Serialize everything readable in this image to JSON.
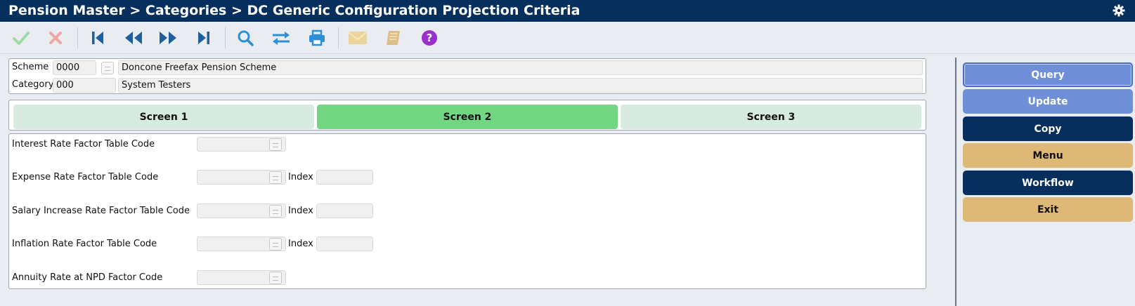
{
  "window": {
    "title": "Pension Master > Categories > DC Generic Configuration Projection Criteria"
  },
  "toolbar": {
    "icons": [
      "accept-icon",
      "cancel-icon",
      "first-record-icon",
      "previous-record-icon",
      "next-record-icon",
      "last-record-icon",
      "search-icon",
      "swap-icon",
      "print-icon",
      "mail-icon",
      "notes-icon",
      "help-icon"
    ]
  },
  "header": {
    "scheme_label": "Scheme",
    "scheme_code": "0000",
    "scheme_name": "Doncone Freefax Pension Scheme",
    "category_label": "Category",
    "category_code": "000",
    "category_name": "System Testers"
  },
  "tabs": [
    {
      "label": "Screen 1",
      "active": false
    },
    {
      "label": "Screen 2",
      "active": true
    },
    {
      "label": "Screen 3",
      "active": false
    }
  ],
  "form": {
    "interest_label": "Interest Rate Factor Table Code",
    "interest_value": "",
    "expense_label": "Expense Rate Factor Table Code",
    "expense_value": "",
    "expense_index_label": "Index",
    "expense_index_value": "",
    "salary_label": "Salary Increase Rate Factor Table Code",
    "salary_value": "",
    "salary_index_label": "Index",
    "salary_index_value": "",
    "inflation_label": "Inflation Rate Factor Table Code",
    "inflation_value": "",
    "inflation_index_label": "Index",
    "inflation_index_value": "",
    "annuity_label": "Annuity Rate at NPD Factor Code",
    "annuity_value": ""
  },
  "side_buttons": {
    "query": "Query",
    "update": "Update",
    "copy": "Copy",
    "menu": "Menu",
    "workflow": "Workflow",
    "exit": "Exit"
  },
  "colors": {
    "title_bar": "#062f5e",
    "tab_active": "#73d683",
    "tab_inactive": "#d7ebe0",
    "button_light_blue": "#6f8fd8",
    "button_navy": "#062f5e",
    "button_tan": "#ddb877"
  }
}
